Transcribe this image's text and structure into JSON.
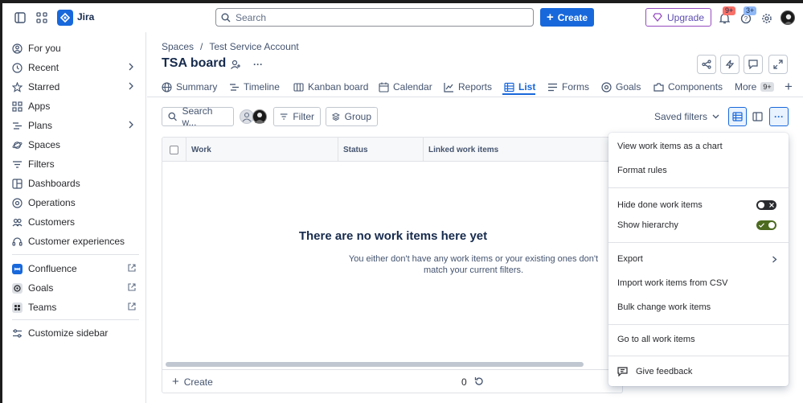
{
  "colors": {
    "brand": "#1868db",
    "upgrade": "#964ac0",
    "toggle_on": "#4c6b1f",
    "toggle_off": "#292a2e"
  },
  "topnav": {
    "brand": "Jira",
    "search_placeholder": "Search",
    "create_label": "Create",
    "upgrade_label": "Upgrade",
    "notifications_badge": "9+",
    "help_badge": "3+"
  },
  "sidebar": {
    "items": [
      {
        "label": "For you",
        "icon": "user-circle-icon"
      },
      {
        "label": "Recent",
        "icon": "clock-icon",
        "chevron": true
      },
      {
        "label": "Starred",
        "icon": "star-icon",
        "chevron": true
      },
      {
        "label": "Apps",
        "icon": "apps-grid-icon"
      },
      {
        "label": "Plans",
        "icon": "plans-icon",
        "chevron": true
      },
      {
        "label": "Spaces",
        "icon": "planet-icon"
      },
      {
        "label": "Filters",
        "icon": "filter-icon"
      },
      {
        "label": "Dashboards",
        "icon": "dashboard-icon"
      },
      {
        "label": "Operations",
        "icon": "operations-icon"
      },
      {
        "label": "Customers",
        "icon": "customers-icon"
      },
      {
        "label": "Customer experiences",
        "icon": "headset-icon"
      }
    ],
    "apps": [
      {
        "label": "Confluence",
        "icon": "confluence-icon",
        "color": "#1868db"
      },
      {
        "label": "Goals",
        "icon": "goals-icon",
        "color": "#dcdfe4"
      },
      {
        "label": "Teams",
        "icon": "teams-icon",
        "color": "#dcdfe4"
      }
    ],
    "customize_label": "Customize sidebar"
  },
  "main": {
    "breadcrumbs": [
      "Spaces",
      "/",
      "Test Service Account"
    ],
    "title": "TSA board",
    "more_actions": "···",
    "tabs": [
      {
        "label": "Summary",
        "icon": "globe-icon"
      },
      {
        "label": "Timeline",
        "icon": "timeline-icon"
      },
      {
        "label": "Kanban board",
        "icon": "board-icon"
      },
      {
        "label": "Calendar",
        "icon": "calendar-icon"
      },
      {
        "label": "Reports",
        "icon": "chart-icon"
      },
      {
        "label": "List",
        "icon": "list-icon",
        "active": true
      },
      {
        "label": "Forms",
        "icon": "forms-icon"
      },
      {
        "label": "Goals",
        "icon": "target-icon"
      },
      {
        "label": "Components",
        "icon": "component-icon"
      },
      {
        "label": "More",
        "icon": "chevron-icon"
      }
    ],
    "more_badge": "9+",
    "toolbar": {
      "search_placeholder": "Search w...",
      "filter_label": "Filter",
      "group_label": "Group",
      "saved_filters_label": "Saved filters"
    },
    "table": {
      "columns": [
        "Work",
        "Status",
        "Linked work items"
      ],
      "empty_title": "There are no work items here yet",
      "empty_text": "You either don't have any work items or your existing ones don't match your current filters.",
      "create_label": "Create",
      "count": "0"
    }
  },
  "menu": {
    "items": [
      {
        "label": "View work items as a chart"
      },
      {
        "label": "Format rules"
      },
      {
        "label": "Hide done work items",
        "toggle": "off"
      },
      {
        "label": "Show hierarchy",
        "toggle": "on"
      },
      {
        "label": "Export"
      },
      {
        "label": "Import work items from CSV"
      },
      {
        "label": "Bulk change work items"
      },
      {
        "label": "Go to all work items"
      },
      {
        "label": "Give feedback"
      }
    ]
  }
}
